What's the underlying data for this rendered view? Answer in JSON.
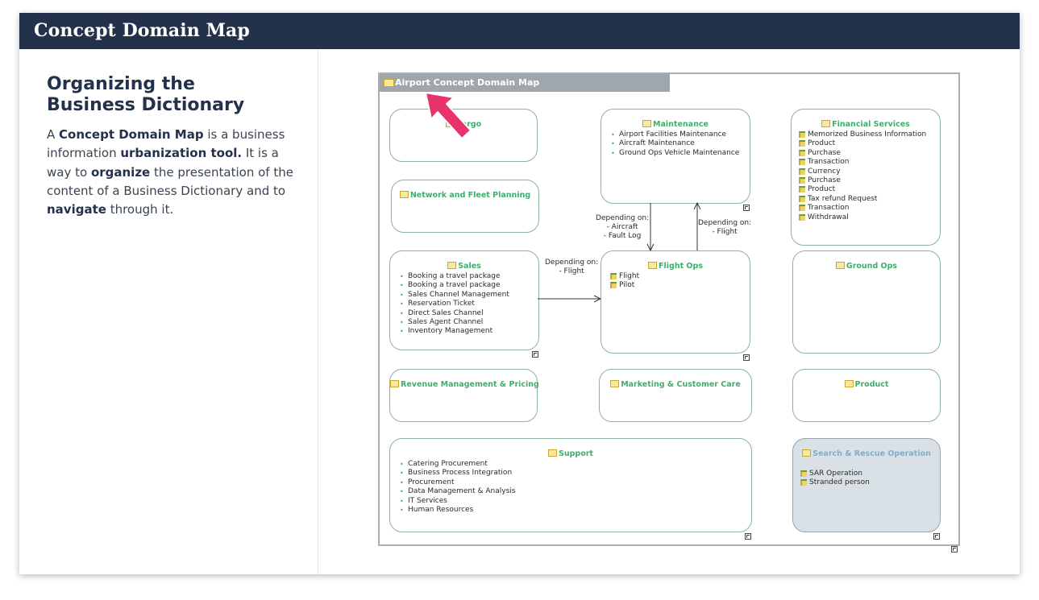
{
  "header": {
    "title": "Concept Domain Map"
  },
  "intro": {
    "title": "Organizing the Business Dictionary",
    "body": [
      {
        "text": "A ",
        "bold": false
      },
      {
        "text": "Concept Domain Map",
        "bold": true
      },
      {
        "text": " is a business information ",
        "bold": false
      },
      {
        "text": "urbanization tool.",
        "bold": true
      },
      {
        "text": " It is a way to ",
        "bold": false
      },
      {
        "text": "organize",
        "bold": true
      },
      {
        "text": " the presentation of the content of a Business Dictionary and to ",
        "bold": false
      },
      {
        "text": "navigate",
        "bold": true
      },
      {
        "text": " through it.",
        "bold": false
      }
    ]
  },
  "diagram": {
    "title": "Airport Concept Domain Map",
    "domains": {
      "cargo": {
        "title": "Cargo"
      },
      "maintenance": {
        "title": "Maintenance",
        "items": [
          "Airport Facilities Maintenance",
          "Aircraft Maintenance",
          "Ground Ops Vehicle Maintenance"
        ]
      },
      "financial": {
        "title": "Financial Services",
        "items": [
          "Memorized Business Information",
          "Product",
          "Purchase",
          "Transaction",
          "Currency",
          "Purchase",
          "Product",
          "Tax refund Request",
          "Transaction",
          "Withdrawal"
        ]
      },
      "network": {
        "title": "Network and Fleet Planning"
      },
      "sales": {
        "title": "Sales",
        "items": [
          "Booking a travel package",
          "Booking a travel package",
          "Sales Channel Management",
          "Reservation Ticket",
          "Direct Sales Channel",
          "Sales Agent Channel",
          "Inventory Management"
        ]
      },
      "flightops": {
        "title": "Flight Ops",
        "items": [
          "Flight",
          "Pilot"
        ]
      },
      "groundops": {
        "title": "Ground Ops"
      },
      "revenue": {
        "title": "Revenue Management & Pricing"
      },
      "marketing": {
        "title": "Marketing & Customer Care"
      },
      "product": {
        "title": "Product"
      },
      "support": {
        "title": "Support",
        "items": [
          "Catering Procurement",
          "Business Process Integration",
          "Procurement",
          "Data Management & Analysis",
          "IT Services",
          "Human Resources"
        ]
      },
      "sar": {
        "title": "Search & Rescue Operation",
        "items": [
          "SAR Operation",
          "Stranded person"
        ]
      }
    },
    "connectors": {
      "maint_to_flight": [
        "Depending on:",
        "- Aircraft",
        "- Fault Log"
      ],
      "flight_to_maint": [
        "Depending on:",
        "- Flight"
      ],
      "sales_to_flight": [
        "Depending on:",
        "- Flight"
      ]
    }
  },
  "colors": {
    "header_bg": "#23314b",
    "domain_title": "#3fae6a",
    "domain_border": "#8db39b",
    "highlight_domain_bg": "#d9e1e6",
    "pointer_arrow": "#e8336b"
  }
}
